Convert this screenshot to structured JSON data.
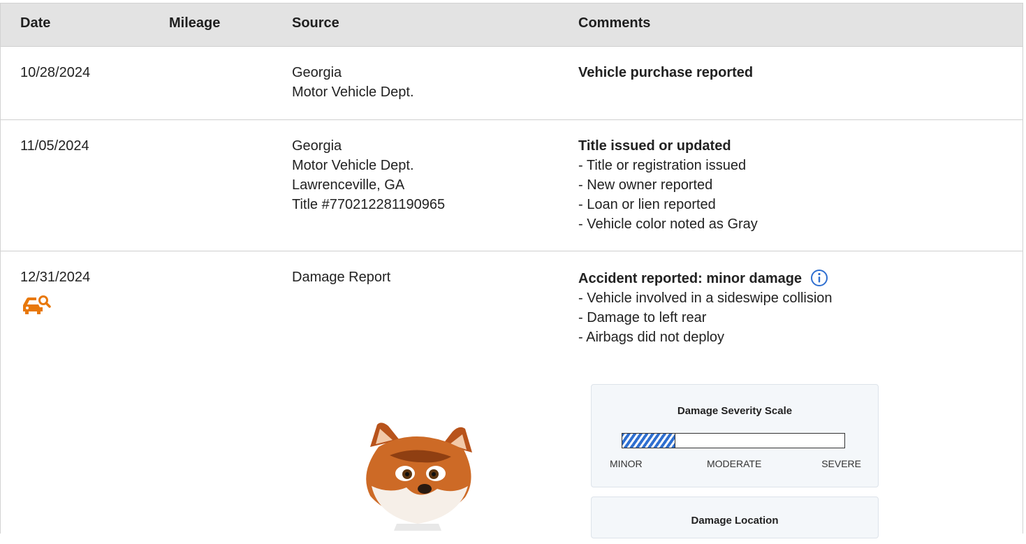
{
  "columns": [
    "Date",
    "Mileage",
    "Source",
    "Comments"
  ],
  "rows": [
    {
      "date": "10/28/2024",
      "mileage": "",
      "source": [
        "Georgia",
        "Motor Vehicle Dept."
      ],
      "comment_title": "Vehicle purchase reported",
      "comment_items": []
    },
    {
      "date": "11/05/2024",
      "mileage": "",
      "source": [
        "Georgia",
        "Motor Vehicle Dept.",
        "Lawrenceville, GA",
        "Title #770212281190965"
      ],
      "comment_title": "Title issued or updated",
      "comment_items": [
        "- Title or registration issued",
        "- New owner reported",
        "- Loan or lien reported",
        "- Vehicle color noted as Gray"
      ]
    },
    {
      "date": "12/31/2024",
      "mileage": "",
      "icon": "damage-inspection-icon",
      "source": [
        "Damage Report"
      ],
      "comment_title": "Accident reported: minor damage",
      "comment_items": [
        "- Vehicle involved in a sideswipe collision",
        "- Damage to left rear",
        "- Airbags did not deploy"
      ]
    }
  ],
  "severity_scale": {
    "title": "Damage Severity Scale",
    "labels": [
      "MINOR",
      "MODERATE",
      "SEVERE"
    ],
    "level_fraction": 0.24,
    "fill_color": "#2f6fd0"
  },
  "damage_location": {
    "title": "Damage Location"
  },
  "colors": {
    "header_bg": "#e3e3e3",
    "info_blue": "#2f6fd0",
    "damage_icon": "#e8780b"
  }
}
